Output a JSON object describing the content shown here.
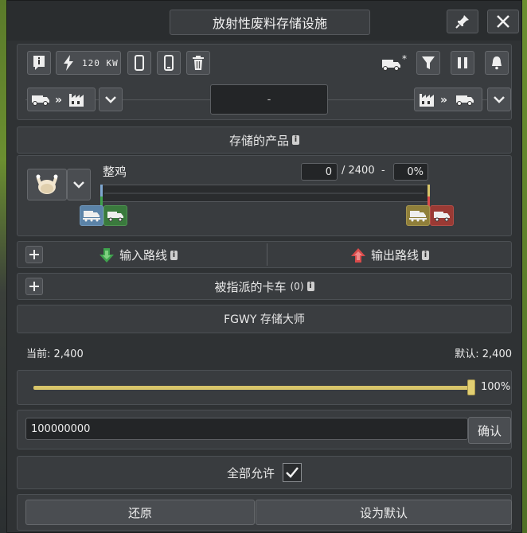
{
  "window": {
    "title": "放射性废料存储设施"
  },
  "toolbar": {
    "power_label": "120 KW"
  },
  "route_center_value": "-",
  "stored_products": {
    "header": "存储的产品",
    "product_name": "整鸡",
    "current_amount": "0",
    "capacity": "/ 2400",
    "dash": "-",
    "percent": "0%",
    "fill_fraction": 0
  },
  "routes": {
    "input_label": "输入路线",
    "output_label": "输出路线"
  },
  "trucks": {
    "label": "被指派的卡车",
    "count": "(0)"
  },
  "fgwy": {
    "title": "FGWY 存储大师",
    "current_label": "当前: 2,400",
    "default_label": "默认: 2,400",
    "slider_percent_label": "100%",
    "slider_fraction": 1.0,
    "input_value": "100000000",
    "confirm_label": "确认"
  },
  "allow_all": {
    "label": "全部允许",
    "checked": true
  },
  "footer": {
    "restore_label": "还原",
    "set_default_label": "设为默认"
  },
  "colors": {
    "accent_gold": "#d8c56a",
    "green": "#3fa34d",
    "red": "#d94b4b"
  }
}
